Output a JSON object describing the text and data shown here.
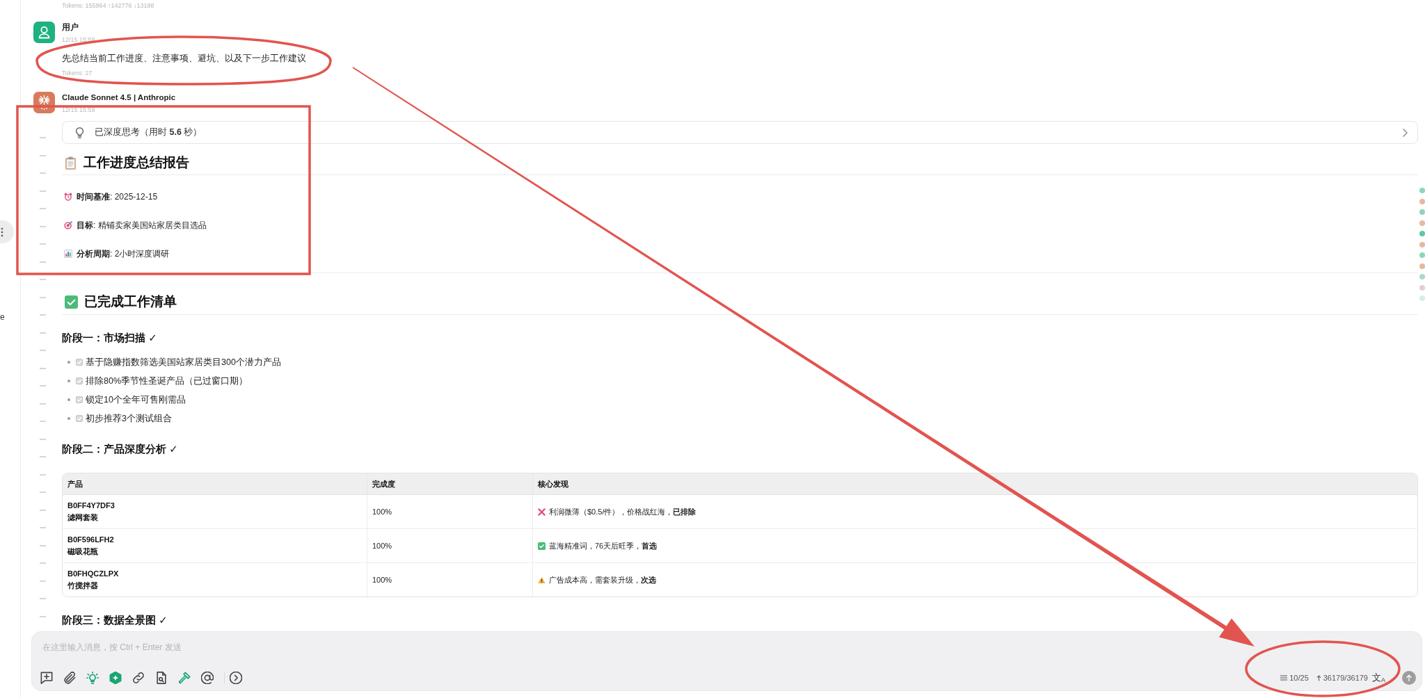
{
  "sidebar": {
    "label": "e"
  },
  "top_tokens": "Tokens: 155964 ↑142776 ↓13188",
  "user_message": {
    "author": "用户",
    "time": "12/15 15:59",
    "text": "先总结当前工作进度、注意事项、避坑、以及下一步工作建议",
    "tokens": "Tokens: 27"
  },
  "assistant_message": {
    "author": "Claude Sonnet 4.5 | Anthropic",
    "time": "12/15 15:59",
    "thinking": {
      "label": "已深度思考（用时 **5.6** 秒）",
      "expanded": false
    },
    "report": {
      "title": "工作进度总结报告",
      "meta": [
        {
          "kind": "time",
          "text": "**时间基准**: 2025-12-15"
        },
        {
          "kind": "goal",
          "text": "**目标**: 精铺卖家美国站家居类目选品"
        },
        {
          "kind": "period",
          "text": "**分析周期**: 2小时深度调研"
        }
      ],
      "section_title": "已完成工作清单",
      "phases": [
        {
          "title": "阶段一：市场扫描 ✓",
          "tasks": [
            {
              "text": "基于隐赚指数筛选美国站家居类目300个潜力产品",
              "checked": true
            },
            {
              "text": "排除80%季节性圣诞产品（已过窗口期）",
              "checked": true
            },
            {
              "text": "锁定10个全年可售刚需品",
              "checked": true
            },
            {
              "text": "初步推荐3个测试组合",
              "checked": true
            }
          ]
        },
        {
          "title": "阶段二：产品深度分析 ✓",
          "table": {
            "columns": [
              "产品",
              "完成度",
              "核心发现"
            ],
            "rows": [
              {
                "code": "B0FF4Y7DF3",
                "name": "滤网套装",
                "completion": "100%",
                "finding": {
                  "kind": "rejected",
                  "text": "利润微薄（$0.5/件），价格战红海，**已排除**"
                }
              },
              {
                "code": "B0F596LFH2",
                "name": "磁吸花瓶",
                "completion": "100%",
                "finding": {
                  "kind": "preferred",
                  "text": "蓝海精准词，76天后旺季，**首选**"
                }
              },
              {
                "code": "B0FHQCZLPX",
                "name": "竹搅拌器",
                "completion": "100%",
                "finding": {
                  "kind": "secondary",
                  "text": "广告成本高，需套装升级，**次选**"
                }
              }
            ]
          }
        },
        {
          "title": "阶段三：数据全景图 ✓"
        }
      ]
    }
  },
  "nav_markers": [
    {
      "color": "#8dd6bd"
    },
    {
      "color": "#e9b79f"
    },
    {
      "color": "#8dd6bd"
    },
    {
      "color": "#e9b79f"
    },
    {
      "color": "#5fc7a2"
    },
    {
      "color": "#e9b79f"
    },
    {
      "color": "#8dd6bd"
    },
    {
      "color": "#e9b79f"
    },
    {
      "color": "#a6dcc8"
    },
    {
      "color": "#e6cfc8"
    },
    {
      "color": "#d3efe4"
    }
  ],
  "composer": {
    "placeholder": "在这里输入消息，按 Ctrl + Enter 发送",
    "tools": [
      {
        "on": false
      },
      {
        "on": false
      },
      {
        "on": true
      },
      {
        "on": true
      },
      {
        "on": false
      },
      {
        "on": false
      },
      {
        "on": true
      },
      {
        "on": false
      },
      {
        "on": false
      }
    ],
    "message_count": "10/25",
    "token_count": "36179/36179",
    "translate": "文$_{A}$",
    "send": {
      "disabled": true
    }
  }
}
